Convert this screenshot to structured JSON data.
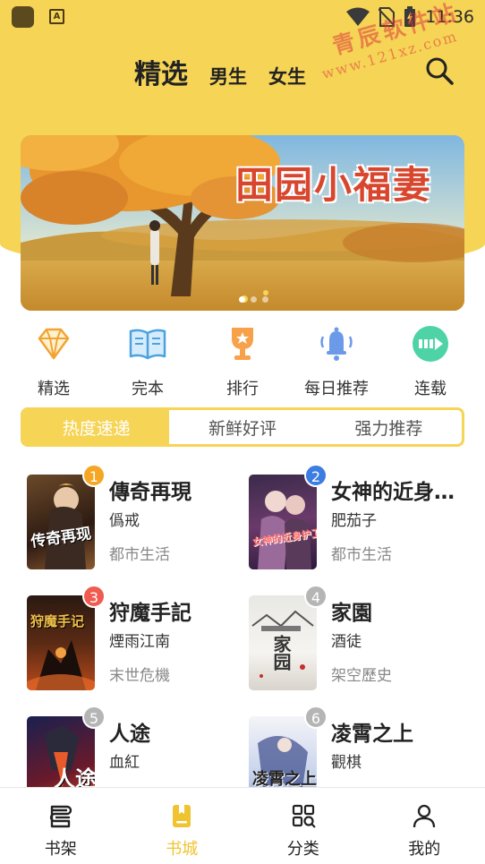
{
  "status_bar": {
    "time": "11:36"
  },
  "header": {
    "tabs": [
      {
        "label": "精选",
        "active": true
      },
      {
        "label": "男生",
        "active": false
      },
      {
        "label": "女生",
        "active": false
      }
    ]
  },
  "watermark": {
    "line1": "青辰软件站",
    "line2": "www.121xz.com"
  },
  "banner": {
    "title": "田园小福妻",
    "slides": 3,
    "active_slide": 0
  },
  "quick_entries": [
    {
      "label": "精选",
      "icon": "diamond-icon"
    },
    {
      "label": "完本",
      "icon": "open-book-icon"
    },
    {
      "label": "排行",
      "icon": "trophy-icon"
    },
    {
      "label": "每日推荐",
      "icon": "bell-icon"
    },
    {
      "label": "连载",
      "icon": "progress-arrow-icon"
    }
  ],
  "segments": [
    {
      "label": "热度速递",
      "active": true
    },
    {
      "label": "新鲜好评",
      "active": false
    },
    {
      "label": "强力推荐",
      "active": false
    }
  ],
  "books": [
    {
      "rank": "1",
      "title": "傳奇再現",
      "author": "僞戒",
      "category": "都市生活",
      "cover_text": "传奇再现",
      "badge_color": "#f5a623"
    },
    {
      "rank": "2",
      "title": "女神的近身…",
      "author": "肥茄子",
      "category": "都市生活",
      "cover_text": "女神的近身护卫",
      "badge_color": "#3b7de0"
    },
    {
      "rank": "3",
      "title": "狩魔手記",
      "author": "煙雨江南",
      "category": "末世危機",
      "cover_text": "狩魔手记",
      "badge_color": "#ef5b4f"
    },
    {
      "rank": "4",
      "title": "家園",
      "author": "酒徒",
      "category": "架空歷史",
      "cover_text": "家园",
      "badge_color": "#b5b5b5"
    },
    {
      "rank": "5",
      "title": "人途",
      "author": "血紅",
      "category": "",
      "cover_text": "人途",
      "badge_color": "#b5b5b5"
    },
    {
      "rank": "6",
      "title": "凌霄之上",
      "author": "觀棋",
      "category": "",
      "cover_text": "凌霄之上",
      "badge_color": "#b5b5b5"
    }
  ],
  "bottom_nav": [
    {
      "label": "书架",
      "icon": "bookshelf-icon",
      "active": false
    },
    {
      "label": "书城",
      "icon": "bookstore-icon",
      "active": true
    },
    {
      "label": "分类",
      "icon": "category-grid-icon",
      "active": false
    },
    {
      "label": "我的",
      "icon": "profile-icon",
      "active": false
    }
  ],
  "colors": {
    "accent": "#f6d456",
    "active_nav": "#f0c330"
  }
}
